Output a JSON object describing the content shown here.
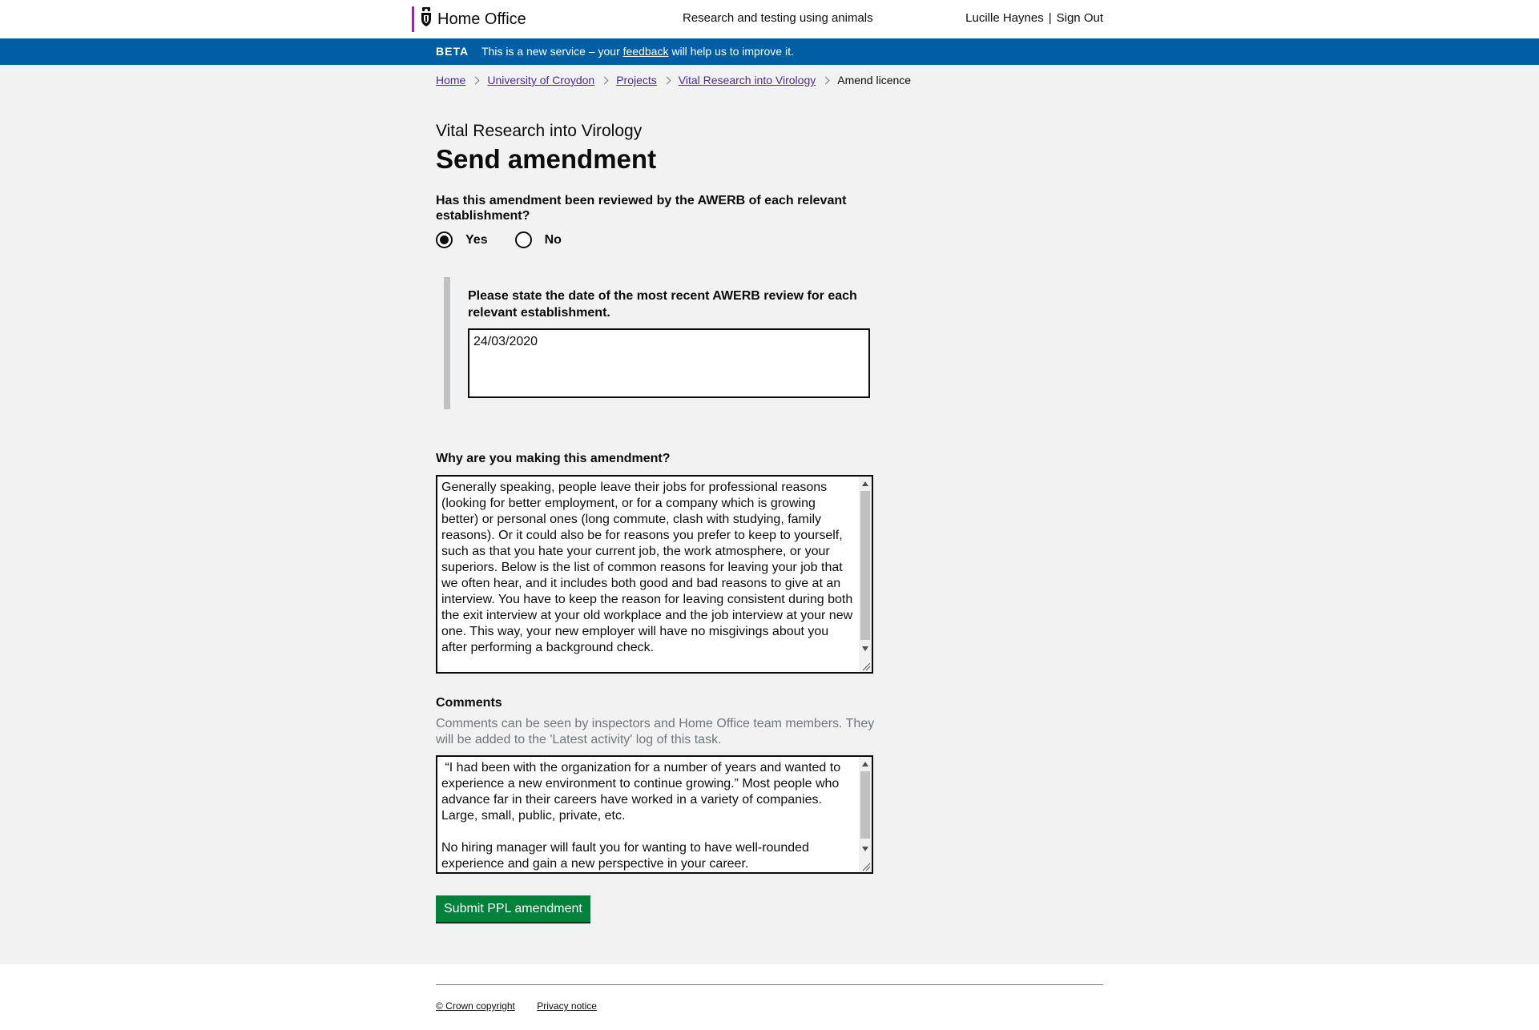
{
  "header": {
    "brand": "Home Office",
    "service_name": "Research and testing using animals",
    "user_name": "Lucille Haynes",
    "separator": "|",
    "sign_out": "Sign Out"
  },
  "beta": {
    "tag": "BETA",
    "message_before": "This is a new service – your ",
    "feedback_link": "feedback",
    "message_after": " will help us to improve it."
  },
  "breadcrumbs": [
    "Home",
    "University of Croydon",
    "Projects",
    "Vital Research into Virology",
    "Amend licence"
  ],
  "page": {
    "caption": "Vital Research into Virology",
    "title": "Send amendment"
  },
  "awerb": {
    "question": "Has this amendment been reviewed by the AWERB of each relevant establishment?",
    "options": [
      "Yes",
      "No"
    ],
    "selected": "Yes",
    "date_label": "Please state the date of the most recent AWERB review for each relevant establishment.",
    "date_value": "24/03/2020"
  },
  "reason": {
    "label": "Why are you making this amendment?",
    "value": "Generally speaking, people leave their jobs for professional reasons (looking for better employment, or for a company which is growing better) or personal ones (long commute, clash with studying, family reasons). Or it could also be for reasons you prefer to keep to yourself, such as that you hate your current job, the work atmosphere, or your superiors. Below is the list of common reasons for leaving your job that we often hear, and it includes both good and bad reasons to give at an interview. You have to keep the reason for leaving consistent during both the exit interview at your old workplace and the job interview at your new one. This way, your new employer will have no misgivings about you after performing a background check."
  },
  "comments": {
    "label": "Comments",
    "hint": "Comments can be seen by inspectors and Home Office team members. They will be added to the 'Latest activity' log of this task.",
    "value": " “I had been with the organization for a number of years and wanted to experience a new environment to continue growing.” Most people who advance far in their careers have worked in a variety of companies. Large, small, public, private, etc.\n\nNo hiring manager will fault you for wanting to have well-rounded experience and gain a new perspective in your career."
  },
  "submit_label": "Submit PPL amendment",
  "footer": {
    "copyright": "© Crown copyright",
    "privacy": "Privacy notice"
  },
  "colors": {
    "beta_banner": "#005ea5",
    "submit_button": "#00823b",
    "link": "#4c2c92",
    "brand_bar": "#9325b2"
  },
  "icons": [
    "crest-icon",
    "chevron-right-icon",
    "scroll-up-icon",
    "scroll-down-icon",
    "resize-grip-icon"
  ]
}
